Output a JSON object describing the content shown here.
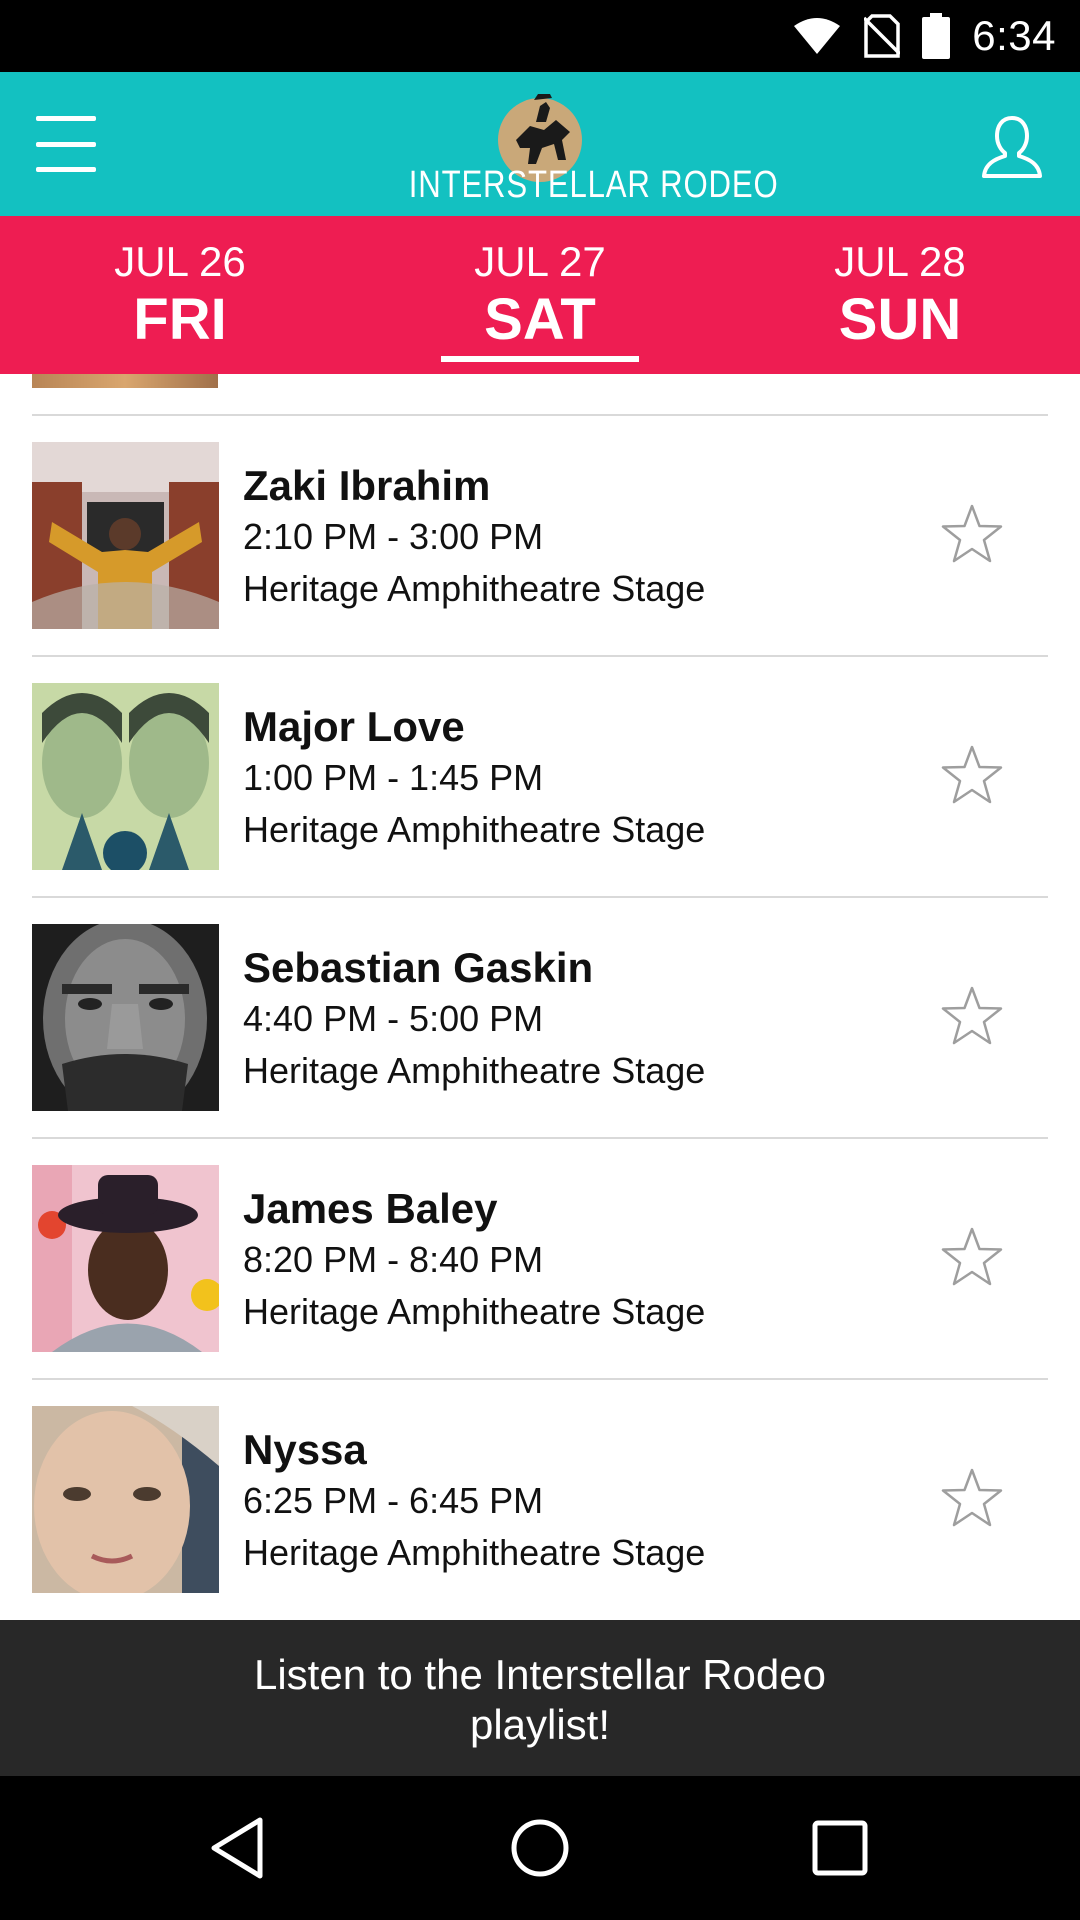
{
  "status_bar": {
    "time": "6:34",
    "icons": [
      "wifi-icon",
      "no-sim-icon",
      "battery-icon"
    ]
  },
  "header": {
    "logo_text": "INTERSTELLAR RODEO",
    "menu_icon": "hamburger-menu-icon",
    "profile_icon": "user-profile-icon"
  },
  "days": [
    {
      "date": "JUL 26",
      "day": "FRI",
      "selected": false
    },
    {
      "date": "JUL 27",
      "day": "SAT",
      "selected": true
    },
    {
      "date": "JUL 28",
      "day": "SUN",
      "selected": false
    }
  ],
  "artists": [
    {
      "name": "Zaki Ibrahim",
      "time": "2:10 PM - 3:00 PM",
      "stage": "Heritage Amphitheatre Stage",
      "favorited": false
    },
    {
      "name": "Major Love",
      "time": "1:00 PM - 1:45 PM",
      "stage": "Heritage Amphitheatre Stage",
      "favorited": false
    },
    {
      "name": "Sebastian Gaskin",
      "time": "4:40 PM - 5:00 PM",
      "stage": "Heritage Amphitheatre Stage",
      "favorited": false
    },
    {
      "name": "James Baley",
      "time": "8:20 PM - 8:40 PM",
      "stage": "Heritage Amphitheatre Stage",
      "favorited": false
    },
    {
      "name": "Nyssa",
      "time": "6:25 PM - 6:45 PM",
      "stage": "Heritage Amphitheatre Stage",
      "favorited": false
    }
  ],
  "playlist_banner": {
    "text": "Listen to the Interstellar Rodeo playlist!"
  },
  "nav": {
    "back_icon": "back-triangle-icon",
    "home_icon": "home-circle-icon",
    "recents_icon": "recents-square-icon"
  },
  "colors": {
    "header": "#13c1c1",
    "tabs": "#ee1d52",
    "banner": "#282828"
  }
}
